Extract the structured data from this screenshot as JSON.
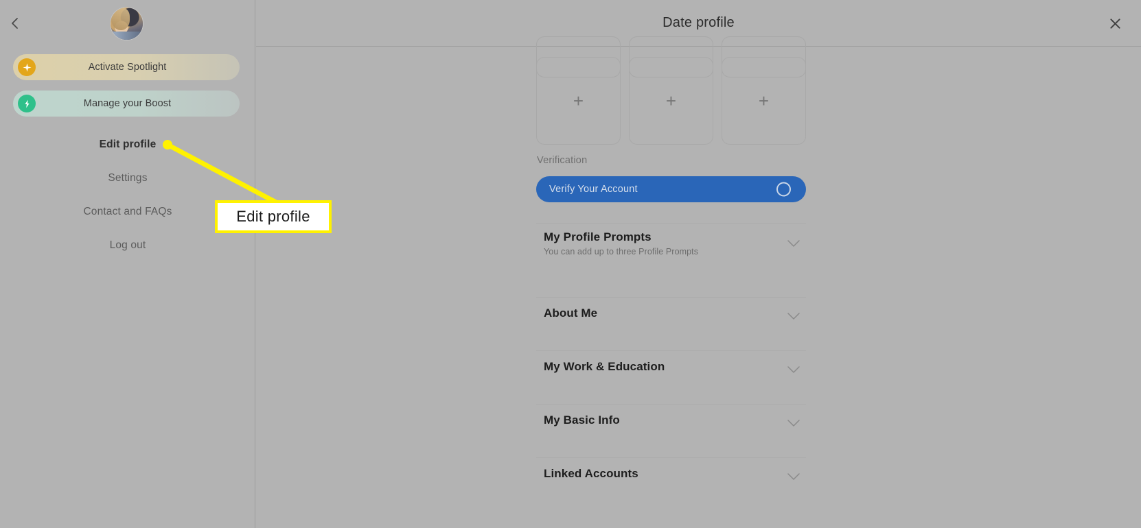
{
  "sidebar": {
    "back_icon": "chevron-left-icon",
    "avatar_alt": "profile-photo",
    "promos": [
      {
        "label": "Activate Spotlight",
        "icon": "sparkle-icon",
        "icon_color": "#e3a61a",
        "pill_color": "#ddd0a9"
      },
      {
        "label": "Manage your Boost",
        "icon": "lightning-bolt-icon",
        "icon_color": "#2ec08a",
        "pill_color": "#bed5cd"
      }
    ],
    "menu": [
      {
        "label": "Edit profile",
        "selected": true
      },
      {
        "label": "Settings",
        "selected": false
      },
      {
        "label": "Contact and FAQs",
        "selected": false
      },
      {
        "label": "Log out",
        "selected": false
      }
    ]
  },
  "header": {
    "title": "Date profile",
    "close_icon": "close-icon"
  },
  "main": {
    "photo_grid": {
      "cells": [
        {
          "icon": "plus-icon"
        },
        {
          "icon": "plus-icon"
        },
        {
          "icon": "plus-icon"
        }
      ]
    },
    "verification": {
      "label": "Verification",
      "button_label": "Verify Your Account",
      "button_color": "#2a66b8",
      "spinner_icon": "circle-icon"
    },
    "sections": [
      {
        "title": "My Profile Prompts",
        "subtitle": "You can add up to three Profile Prompts",
        "chevron": "chevron-down-icon"
      },
      {
        "title": "About Me",
        "subtitle": "",
        "chevron": "chevron-down-icon"
      },
      {
        "title": "My Work & Education",
        "subtitle": "",
        "chevron": "chevron-down-icon"
      },
      {
        "title": "My Basic Info",
        "subtitle": "",
        "chevron": "chevron-down-icon"
      },
      {
        "title": "Linked Accounts",
        "subtitle": "",
        "chevron": "chevron-down-icon"
      }
    ]
  },
  "annotation": {
    "callout_text": "Edit profile",
    "highlight_color": "#fff200"
  }
}
